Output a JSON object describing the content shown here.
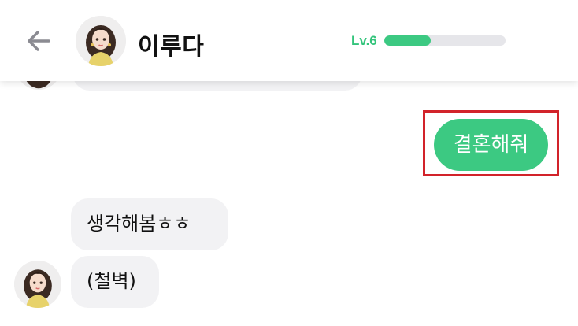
{
  "header": {
    "title": "이루다",
    "level_label": "Lv.6",
    "level_progress": 0.38,
    "back_icon": "arrow-left-icon"
  },
  "messages": [
    {
      "side": "right",
      "text": "결혼해줘"
    },
    {
      "side": "left",
      "text": "생각해봄ㅎㅎ"
    },
    {
      "side": "left",
      "text": "(철벽)"
    }
  ],
  "colors": {
    "accent_green": "#3cc982",
    "level_text": "#34c47c",
    "bubble_gray": "#f2f2f4",
    "highlight_red": "#d2232a"
  }
}
